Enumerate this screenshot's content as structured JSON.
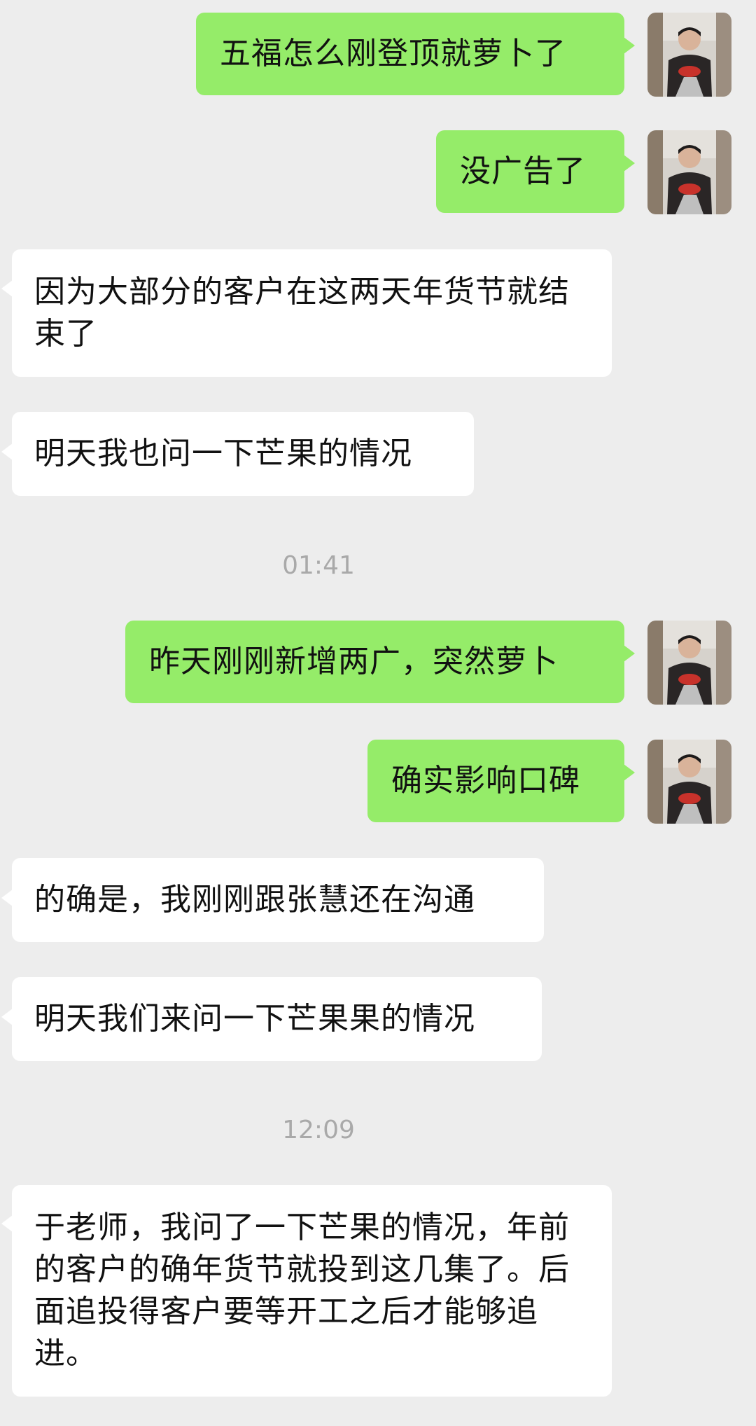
{
  "colors": {
    "background": "#ededed",
    "outgoing_bubble": "#95ec69",
    "incoming_bubble": "#ffffff",
    "timestamp_text": "#a9a9a9"
  },
  "avatar_icon": "user-photo-avatar",
  "messages": [
    {
      "direction": "outgoing",
      "text": "五福怎么刚登顶就萝卜了"
    },
    {
      "direction": "outgoing",
      "text": "没广告了"
    },
    {
      "direction": "incoming",
      "text": "因为大部分的客户在这两天年货节就结束了"
    },
    {
      "direction": "incoming",
      "text": "明天我也问一下芒果的情况"
    },
    {
      "direction": "outgoing",
      "text": "昨天刚刚新增两广，突然萝卜"
    },
    {
      "direction": "outgoing",
      "text": "确实影响口碑"
    },
    {
      "direction": "incoming",
      "text": "的确是，我刚刚跟张慧还在沟通"
    },
    {
      "direction": "incoming",
      "text": "明天我们来问一下芒果果的情况"
    },
    {
      "direction": "incoming",
      "text": "于老师，我问了一下芒果的情况，年前的客户的确年货节就投到这几集了。后面追投得客户要等开工之后才能够追进。"
    }
  ],
  "timestamps": [
    "01:41",
    "12:09"
  ]
}
